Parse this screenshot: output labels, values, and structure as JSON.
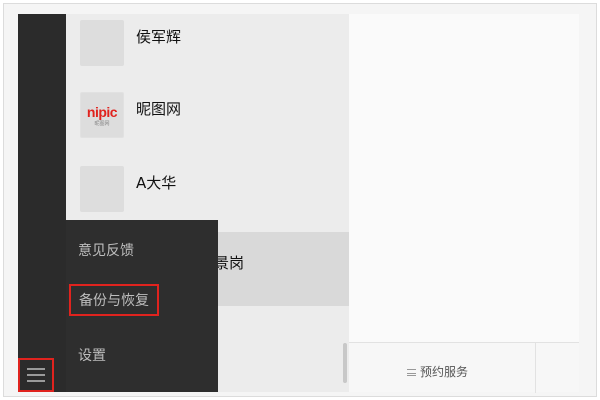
{
  "contacts": [
    {
      "name": "侯军辉",
      "avatar": "portrait-avatar"
    },
    {
      "name": "昵图网",
      "avatar": "nipic-logo-avatar",
      "logo_text": "nipic",
      "logo_sub": "昵图网"
    },
    {
      "name": "A大华",
      "avatar": "masked-girl-avatar"
    },
    {
      "name": "景岗",
      "avatar": "hidden-avatar"
    }
  ],
  "menu": {
    "items": [
      "意见反馈",
      "备份与恢复",
      "设置"
    ],
    "highlighted_item": "备份与恢复"
  },
  "right_panel": {
    "service_label": "预约服务"
  },
  "colors": {
    "highlight_border": "#e0231e",
    "menu_bg": "#2e2e2e",
    "nav_bg": "#2b2b2b"
  }
}
